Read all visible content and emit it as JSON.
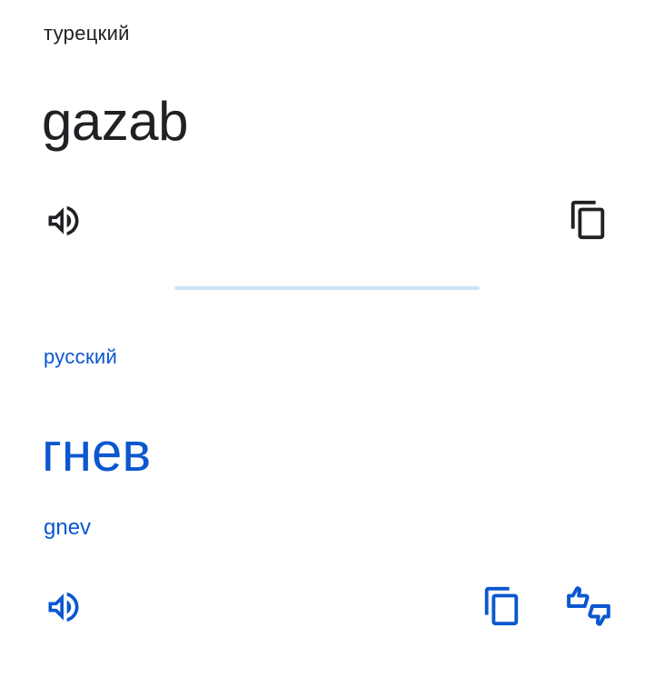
{
  "source": {
    "language": "турецкий",
    "text": "gazab",
    "icons": {
      "listen": "speaker-icon",
      "copy": "copy-icon"
    },
    "color": "#202124"
  },
  "target": {
    "language": "русский",
    "text": "гнев",
    "transliteration": "gnev",
    "icons": {
      "listen": "speaker-icon",
      "copy": "copy-icon",
      "rate": "thumbs-rate-icon"
    },
    "color": "#0b57d0"
  },
  "divider_color": "#cde4f5"
}
